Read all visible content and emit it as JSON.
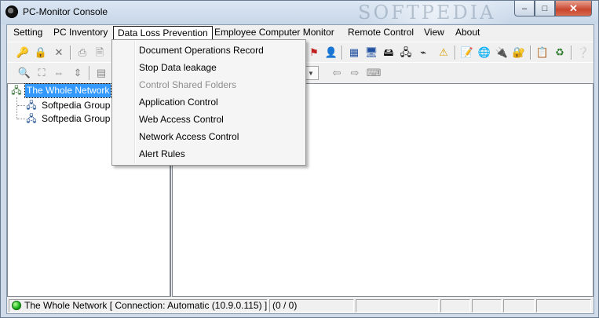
{
  "window": {
    "title": "PC-Monitor Console",
    "watermark": "SOFTPEDIA",
    "controls": {
      "minimize": "–",
      "maximize": "□",
      "close": "✕"
    }
  },
  "menubar": {
    "items": [
      {
        "label": "Setting"
      },
      {
        "label": "PC Inventory"
      },
      {
        "label": "Data Loss Prevention"
      },
      {
        "label": "Employee Computer Monitor"
      },
      {
        "label": "Remote Control"
      },
      {
        "label": "View"
      },
      {
        "label": "About"
      }
    ],
    "active": "Data Loss Prevention"
  },
  "dropdown": {
    "items": [
      {
        "label": "Document Operations Record",
        "enabled": true
      },
      {
        "label": "Stop Data leakage",
        "enabled": true
      },
      {
        "label": "Control Shared Folders",
        "enabled": false
      },
      {
        "label": "Application Control",
        "enabled": true
      },
      {
        "label": "Web Access Control",
        "enabled": true
      },
      {
        "label": "Network Access Control",
        "enabled": true
      },
      {
        "label": "Alert Rules",
        "enabled": true
      }
    ]
  },
  "toolbar1": {
    "icons": [
      "user-key-icon",
      "lock-user-icon",
      "delete-icon",
      "print-icon",
      "print-preview-icon",
      "flag-icon",
      "search-user-icon",
      "list-view-icon",
      "computer-icon",
      "hardware-icon",
      "network-icon",
      "usb-icon",
      "warning-icon",
      "notes-icon",
      "globe-icon",
      "plug-icon",
      "lock-icon",
      "refresh-icon",
      "help-icon"
    ]
  },
  "toolbar2": {
    "icons": [
      "zoom-icon",
      "fit-icon",
      "fit-width-icon",
      "fit-height-icon",
      "grid-icon",
      "back-arrow-icon",
      "forward-arrow-icon",
      "keyboard-icon"
    ]
  },
  "tree": {
    "root": "The Whole Network",
    "children": [
      "Softpedia Group 1",
      "Softpedia Group 2"
    ]
  },
  "content": {
    "watermark": "softpedia"
  },
  "status": {
    "connection": "The Whole Network [ Connection: Automatic (10.9.0.115) ]",
    "count": "(0 / 0)"
  },
  "colors": {
    "selection": "#3399ff",
    "status_dot": "#17b018",
    "frame": "#cfdbe9"
  }
}
